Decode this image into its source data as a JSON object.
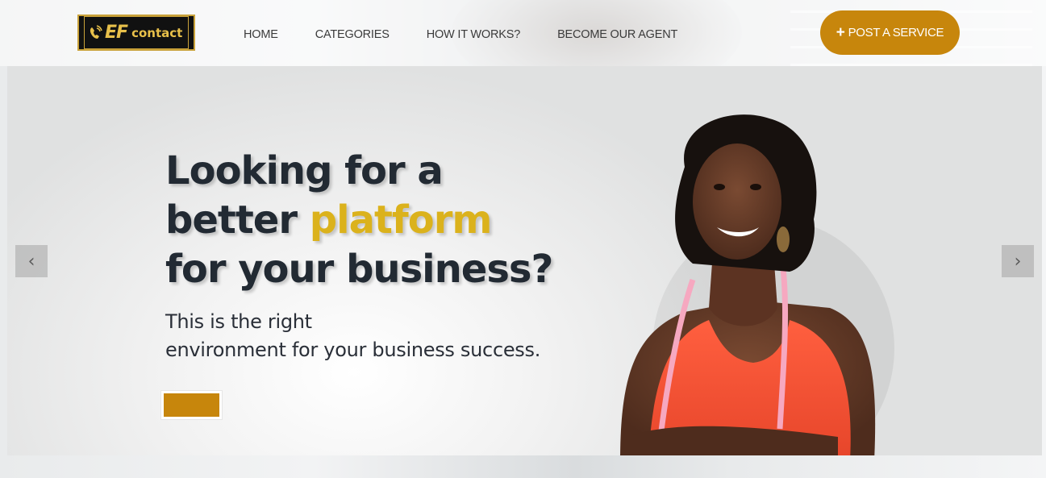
{
  "brand": {
    "logo_ef": "EF",
    "logo_contact": "contact",
    "accent_color": "#c7860c",
    "highlight_color": "#dbb21c"
  },
  "nav": {
    "items": [
      {
        "label": "HOME"
      },
      {
        "label": "CATEGORIES"
      },
      {
        "label": "HOW IT WORKS?"
      },
      {
        "label": "BECOME OUR AGENT"
      }
    ]
  },
  "header": {
    "post_button_icon": "+",
    "post_button_label": "POST A SERVICE"
  },
  "hero": {
    "title_line1": "Looking for a",
    "title_line2_prefix": "better ",
    "title_line2_accent": "platform",
    "title_line3": "for your business?",
    "subtitle_line1": "This is the right",
    "subtitle_line2": "environment for your business success.",
    "prev_arrow": "‹",
    "next_arrow": "›"
  }
}
